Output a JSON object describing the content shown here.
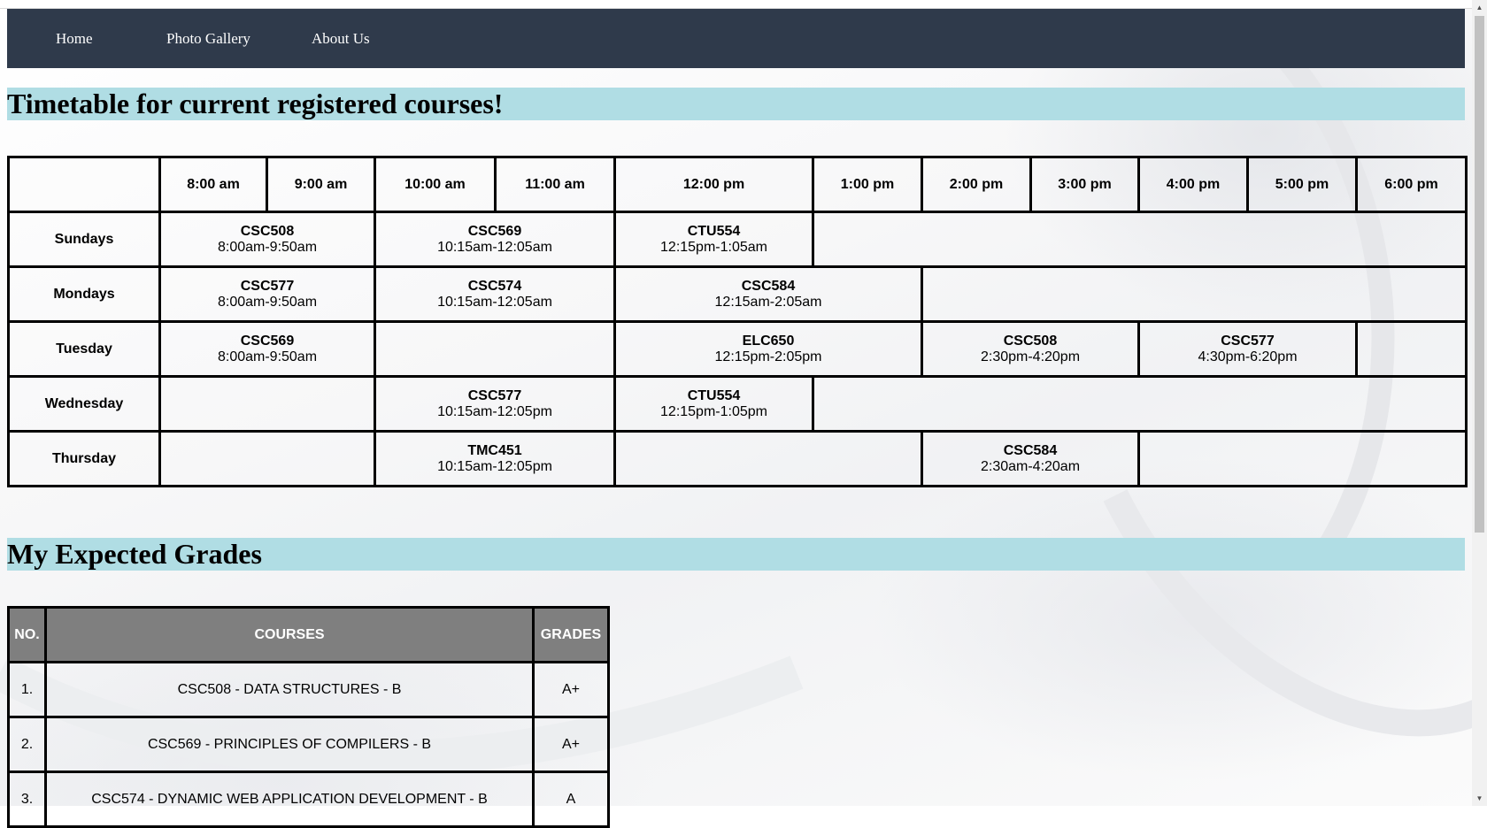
{
  "nav": {
    "items": [
      "Home",
      "Photo Gallery",
      "About Us"
    ]
  },
  "timetable": {
    "title": "Timetable for current registered courses!",
    "time_headers": [
      "8:00 am",
      "9:00 am",
      "10:00 am",
      "11:00 am",
      "12:00 pm",
      "1:00 pm",
      "2:00 pm",
      "3:00 pm",
      "4:00 pm",
      "5:00 pm",
      "6:00 pm"
    ],
    "rows": [
      {
        "day": "Sundays",
        "slots": [
          {
            "code": "CSC508",
            "time": "8:00am-9:50am"
          },
          {
            "code": "CSC569",
            "time": "10:15am-12:05am"
          },
          {
            "code": "CTU554",
            "time": "12:15pm-1:05am"
          }
        ]
      },
      {
        "day": "Mondays",
        "slots": [
          {
            "code": "CSC577",
            "time": "8:00am-9:50am"
          },
          {
            "code": "CSC574",
            "time": "10:15am-12:05am"
          },
          {
            "code": "CSC584",
            "time": "12:15am-2:05am"
          }
        ]
      },
      {
        "day": "Tuesday",
        "slots": [
          {
            "code": "CSC569",
            "time": "8:00am-9:50am"
          },
          {
            "code": "ELC650",
            "time": "12:15pm-2:05pm"
          },
          {
            "code": "CSC508",
            "time": "2:30pm-4:20pm"
          },
          {
            "code": "CSC577",
            "time": "4:30pm-6:20pm"
          }
        ]
      },
      {
        "day": "Wednesday",
        "slots": [
          {
            "code": "CSC577",
            "time": "10:15am-12:05pm"
          },
          {
            "code": "CTU554",
            "time": "12:15pm-1:05pm"
          }
        ]
      },
      {
        "day": "Thursday",
        "slots": [
          {
            "code": "TMC451",
            "time": "10:15am-12:05pm"
          },
          {
            "code": "CSC584",
            "time": "2:30am-4:20am"
          }
        ]
      }
    ]
  },
  "grades": {
    "title": "My Expected Grades",
    "headers": {
      "no": "NO.",
      "courses": "COURSES",
      "grades": "GRADES"
    },
    "rows": [
      {
        "no": "1.",
        "course": "CSC508 - DATA STRUCTURES - B",
        "grade": "A+"
      },
      {
        "no": "2.",
        "course": "CSC569 - PRINCIPLES OF COMPILERS - B",
        "grade": "A+"
      },
      {
        "no": "3.",
        "course": "CSC574 - DYNAMIC WEB APPLICATION DEVELOPMENT - B",
        "grade": "A"
      }
    ]
  },
  "colors": {
    "navbar": "#2f3a4b",
    "section_title_bg": "#b0dde4",
    "grades_header_bg": "#7f7f7f"
  },
  "icons": {
    "scroll_up": "triangle-up-icon",
    "scroll_down": "triangle-down-icon"
  }
}
